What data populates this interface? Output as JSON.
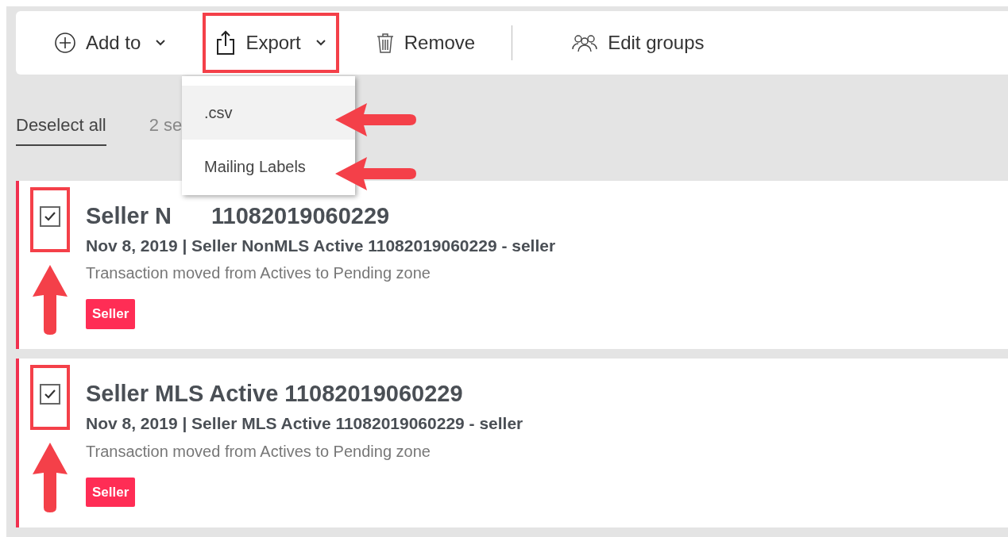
{
  "toolbar": [
    {
      "kind": "add",
      "label": "Add to",
      "caret": true,
      "highlighted": false
    },
    {
      "kind": "export",
      "label": "Export",
      "caret": true,
      "highlighted": true
    },
    {
      "kind": "remove",
      "label": "Remove",
      "caret": false,
      "highlighted": false
    },
    {
      "kind": "groups",
      "label": "Edit groups",
      "caret": false,
      "highlighted": false
    }
  ],
  "selection": {
    "deselect": "Deselect all",
    "count": "2 se"
  },
  "export_menu": [
    {
      "label": ".csv",
      "hovered": true
    },
    {
      "label": "Mailing Labels",
      "hovered": false
    }
  ],
  "cards": [
    {
      "checked": true,
      "title_parts": [
        "Seller N",
        "11082019060229"
      ],
      "subtitle": "Nov 8, 2019 | Seller NonMLS Active 11082019060229 - seller",
      "description": "Transaction moved from Actives to Pending zone",
      "tag": "Seller"
    },
    {
      "checked": true,
      "title_parts": [
        "Seller MLS Active 11082019060229"
      ],
      "subtitle": "Nov 8, 2019 | Seller MLS Active 11082019060229 - seller",
      "description": "Transaction moved from Actives to Pending zone",
      "tag": "Seller"
    }
  ]
}
